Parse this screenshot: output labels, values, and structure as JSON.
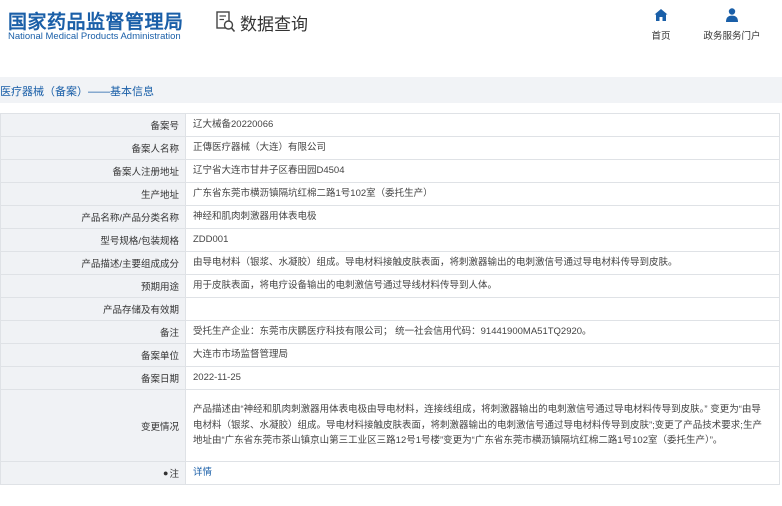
{
  "header": {
    "logo_cn": "国家药品监督管理局",
    "logo_en": "National Medical Products Administration",
    "query_title": "数据查询",
    "nav": [
      {
        "label": "首页",
        "icon": "home-icon"
      },
      {
        "label": "政务服务门户",
        "icon": "user-icon"
      }
    ]
  },
  "section_title": "医疗器械（备案）——基本信息",
  "rows": [
    {
      "label": "备案号",
      "value": "辽大械备20220066"
    },
    {
      "label": "备案人名称",
      "value": "正傳医疗器械（大连）有限公司"
    },
    {
      "label": "备案人注册地址",
      "value": "辽宁省大连市甘井子区春田园D4504"
    },
    {
      "label": "生产地址",
      "value": "广东省东莞市横沥镇隔坑红棉二路1号102室（委托生产）"
    },
    {
      "label": "产品名称/产品分类名称",
      "value": "神经和肌肉刺激器用体表电极"
    },
    {
      "label": "型号规格/包装规格",
      "value": "ZDD001"
    },
    {
      "label": "产品描述/主要组成成分",
      "value": "由导电材料（银浆、水凝胶）组成。导电材料接触皮肤表面，将刺激器输出的电刺激信号通过导电材料传导到皮肤。"
    },
    {
      "label": "预期用途",
      "value": "用于皮肤表面，将电疗设备输出的电刺激信号通过导线材料传导到人体。"
    },
    {
      "label": "产品存储及有效期",
      "value": ""
    },
    {
      "label": "备注",
      "value": "受托生产企业：东莞市庆鹏医疗科技有限公司；  统一社会信用代码：91441900MA51TQ2920。"
    },
    {
      "label": "备案单位",
      "value": "大连市市场监督管理局"
    },
    {
      "label": "备案日期",
      "value": "2022-11-25"
    },
    {
      "label": "变更情况",
      "value": "产品描述由“神经和肌肉刺激器用体表电极由导电材料，连接线组成，将刺激器输出的电刺激信号通过导电材料传导到皮肤。”  变更为“由导电材料（银浆、水凝胶）组成。导电材料接触皮肤表面，将刺激器输出的电刺激信号通过导电材料传导到皮肤”;变更了产品技术要求;生产地址由“广东省东莞市茶山镇京山第三工业区三路12号1号楼”变更为“广东省东莞市横沥镇隔坑红棉二路1号102室（委托生产）”。"
    }
  ],
  "note": {
    "label": "注",
    "link": "详情"
  }
}
